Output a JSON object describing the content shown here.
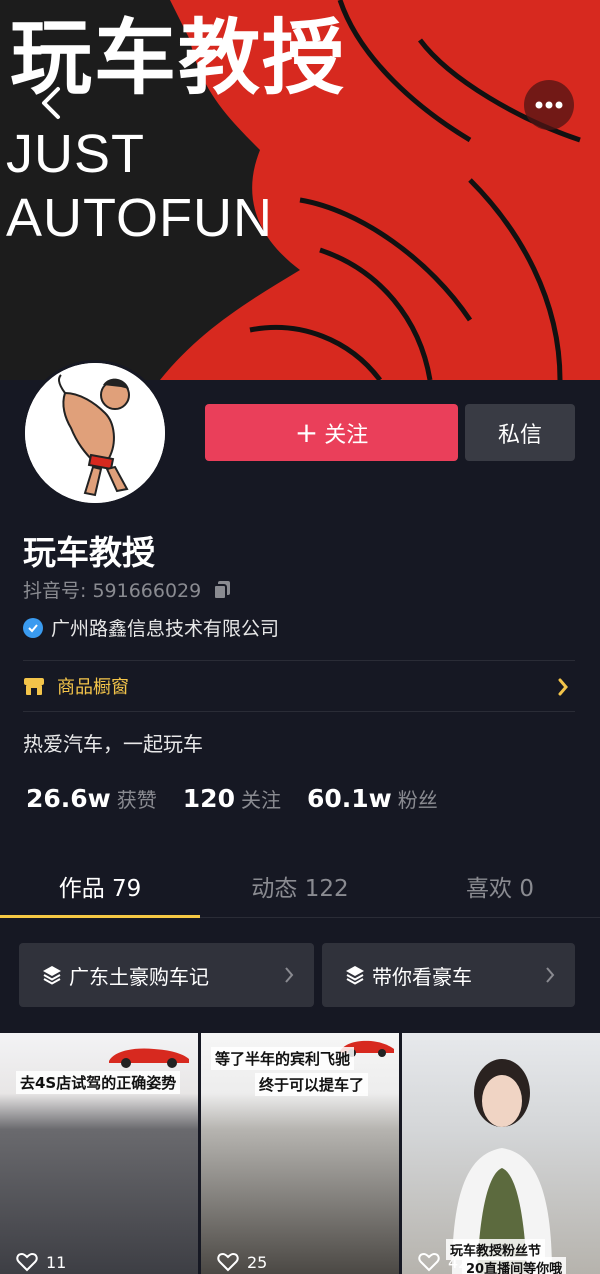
{
  "banner": {
    "title": "玩车教授",
    "subtitle_line1": "JUST",
    "subtitle_line2": "AUTOFUN"
  },
  "profile": {
    "follow_label": "关注",
    "message_label": "私信",
    "name": "玩车教授",
    "douyin_id": "抖音号: 591666029",
    "verified_org": "广州路鑫信息技术有限公司",
    "shop_label": "商品橱窗",
    "bio": "热爱汽车，一起玩车"
  },
  "stats": [
    {
      "value": "26.6w",
      "label": "获赞"
    },
    {
      "value": "120",
      "label": "关注"
    },
    {
      "value": "60.1w",
      "label": "粉丝"
    }
  ],
  "tabs": [
    {
      "label": "作品 79",
      "active": true
    },
    {
      "label": "动态 122",
      "active": false
    },
    {
      "label": "喜欢 0",
      "active": false
    }
  ],
  "collections": [
    {
      "label": "广东土豪购车记"
    },
    {
      "label": "带你看豪车"
    }
  ],
  "videos": [
    {
      "caption": "去4S店试驾的正确姿势",
      "likes": "11"
    },
    {
      "caption_line1": "等了半年的宾利飞驰",
      "caption_line2": "终于可以提车了",
      "likes": "25"
    },
    {
      "caption_line1": "玩车教授粉丝节",
      "caption_line2": "20直播间等你哦",
      "likes": "42"
    }
  ],
  "colors": {
    "background": "#161823",
    "follow_button": "#ea3f5a",
    "accent_yellow": "#f5c844",
    "banner_red": "#d7291f"
  }
}
